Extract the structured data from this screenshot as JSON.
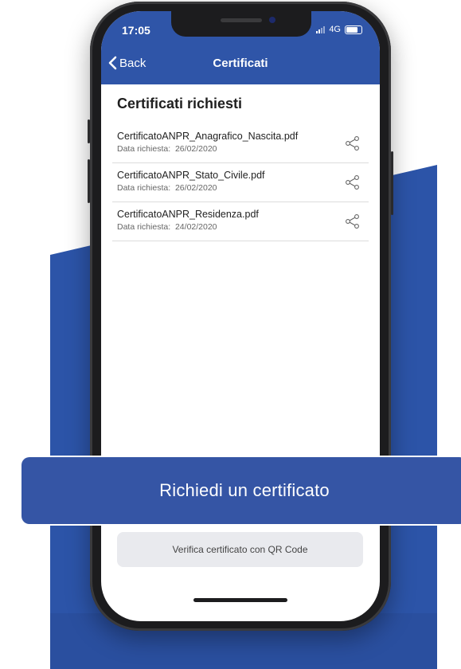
{
  "status_bar": {
    "time": "17:05",
    "network": "4G"
  },
  "header": {
    "back_label": "Back",
    "title": "Certificati"
  },
  "section": {
    "title": "Certificati richiesti"
  },
  "certificates": [
    {
      "name": "CertificatoANPR_Anagrafico_Nascita.pdf",
      "date_label": "Data richiesta:",
      "date": "26/02/2020"
    },
    {
      "name": "CertificatoANPR_Stato_Civile.pdf",
      "date_label": "Data richiesta:",
      "date": "26/02/2020"
    },
    {
      "name": "CertificatoANPR_Residenza.pdf",
      "date_label": "Data richiesta:",
      "date": "24/02/2020"
    }
  ],
  "buttons": {
    "request_certificate": "Richiedi un certificato",
    "verify_qr": "Verifica certificato con QR Code"
  },
  "colors": {
    "brand_blue": "#2f55a8",
    "cta_blue": "#3555a5",
    "background_panel": "#2c54a8"
  }
}
